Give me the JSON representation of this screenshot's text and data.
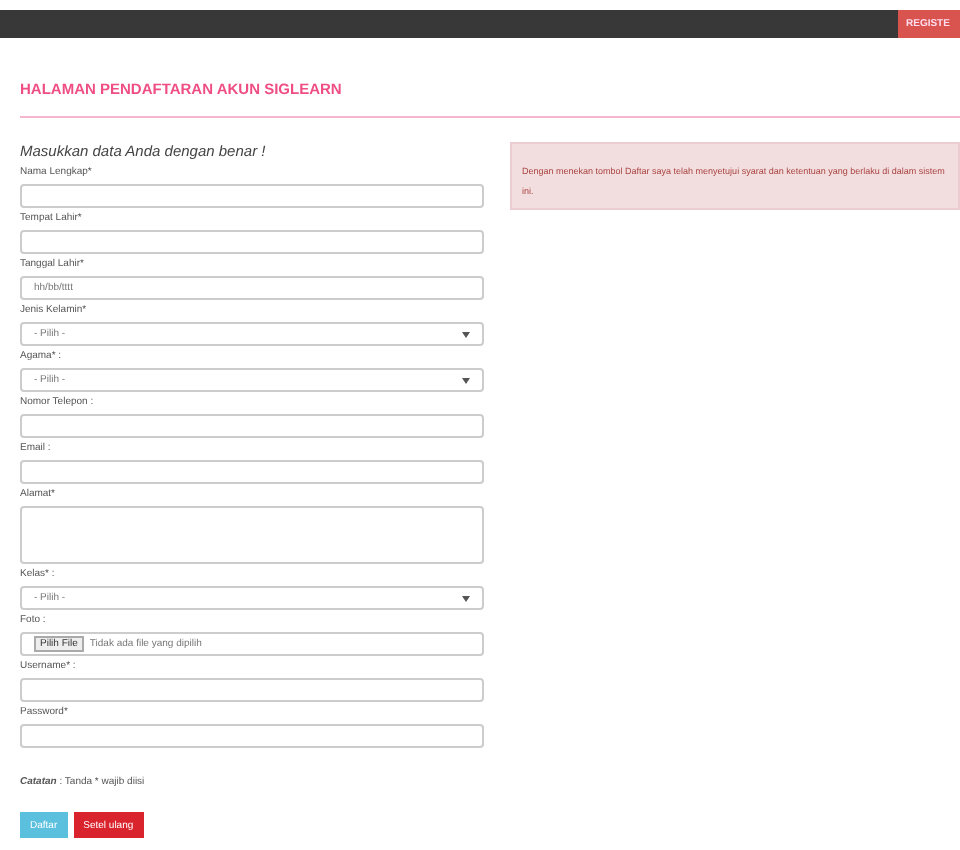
{
  "navbar": {
    "button": "REGISTE"
  },
  "page_title": "HALAMAN PENDAFTARAN AKUN SIGLEARN",
  "form": {
    "heading": "Masukkan data Anda dengan benar !",
    "fields": [
      {
        "kind": "text",
        "label": "Nama Lengkap*"
      },
      {
        "kind": "text",
        "label": "Tempat Lahir*"
      },
      {
        "kind": "date",
        "label": "Tanggal Lahir*",
        "placeholder": "hh/bb/tttt"
      },
      {
        "kind": "select",
        "label": "Jenis Kelamin*",
        "value": "- Pilih -"
      },
      {
        "kind": "select",
        "label": "Agama* :",
        "value": "- Pilih -"
      },
      {
        "kind": "text",
        "label": "Nomor Telepon :"
      },
      {
        "kind": "text",
        "label": "Email :"
      },
      {
        "kind": "textarea",
        "label": "Alamat*"
      },
      {
        "kind": "select",
        "label": "Kelas* :",
        "value": "- Pilih -"
      },
      {
        "kind": "file",
        "label": "Foto :",
        "button": "Pilih File",
        "value": "Tidak ada file yang dipilih"
      },
      {
        "kind": "text",
        "label": "Username* :"
      },
      {
        "kind": "text",
        "label": "Password*"
      }
    ],
    "note_label": "Catatan",
    "note": ": Tanda * wajib diisi",
    "buttons": [
      {
        "kind": "primary",
        "label": "Daftar"
      },
      {
        "kind": "danger",
        "label": "Setel ulang"
      }
    ]
  },
  "alert": "Dengan menekan tombol Daftar saya telah menyetujui syarat dan ketentuan yang berlaku di dalam sistem ini."
}
